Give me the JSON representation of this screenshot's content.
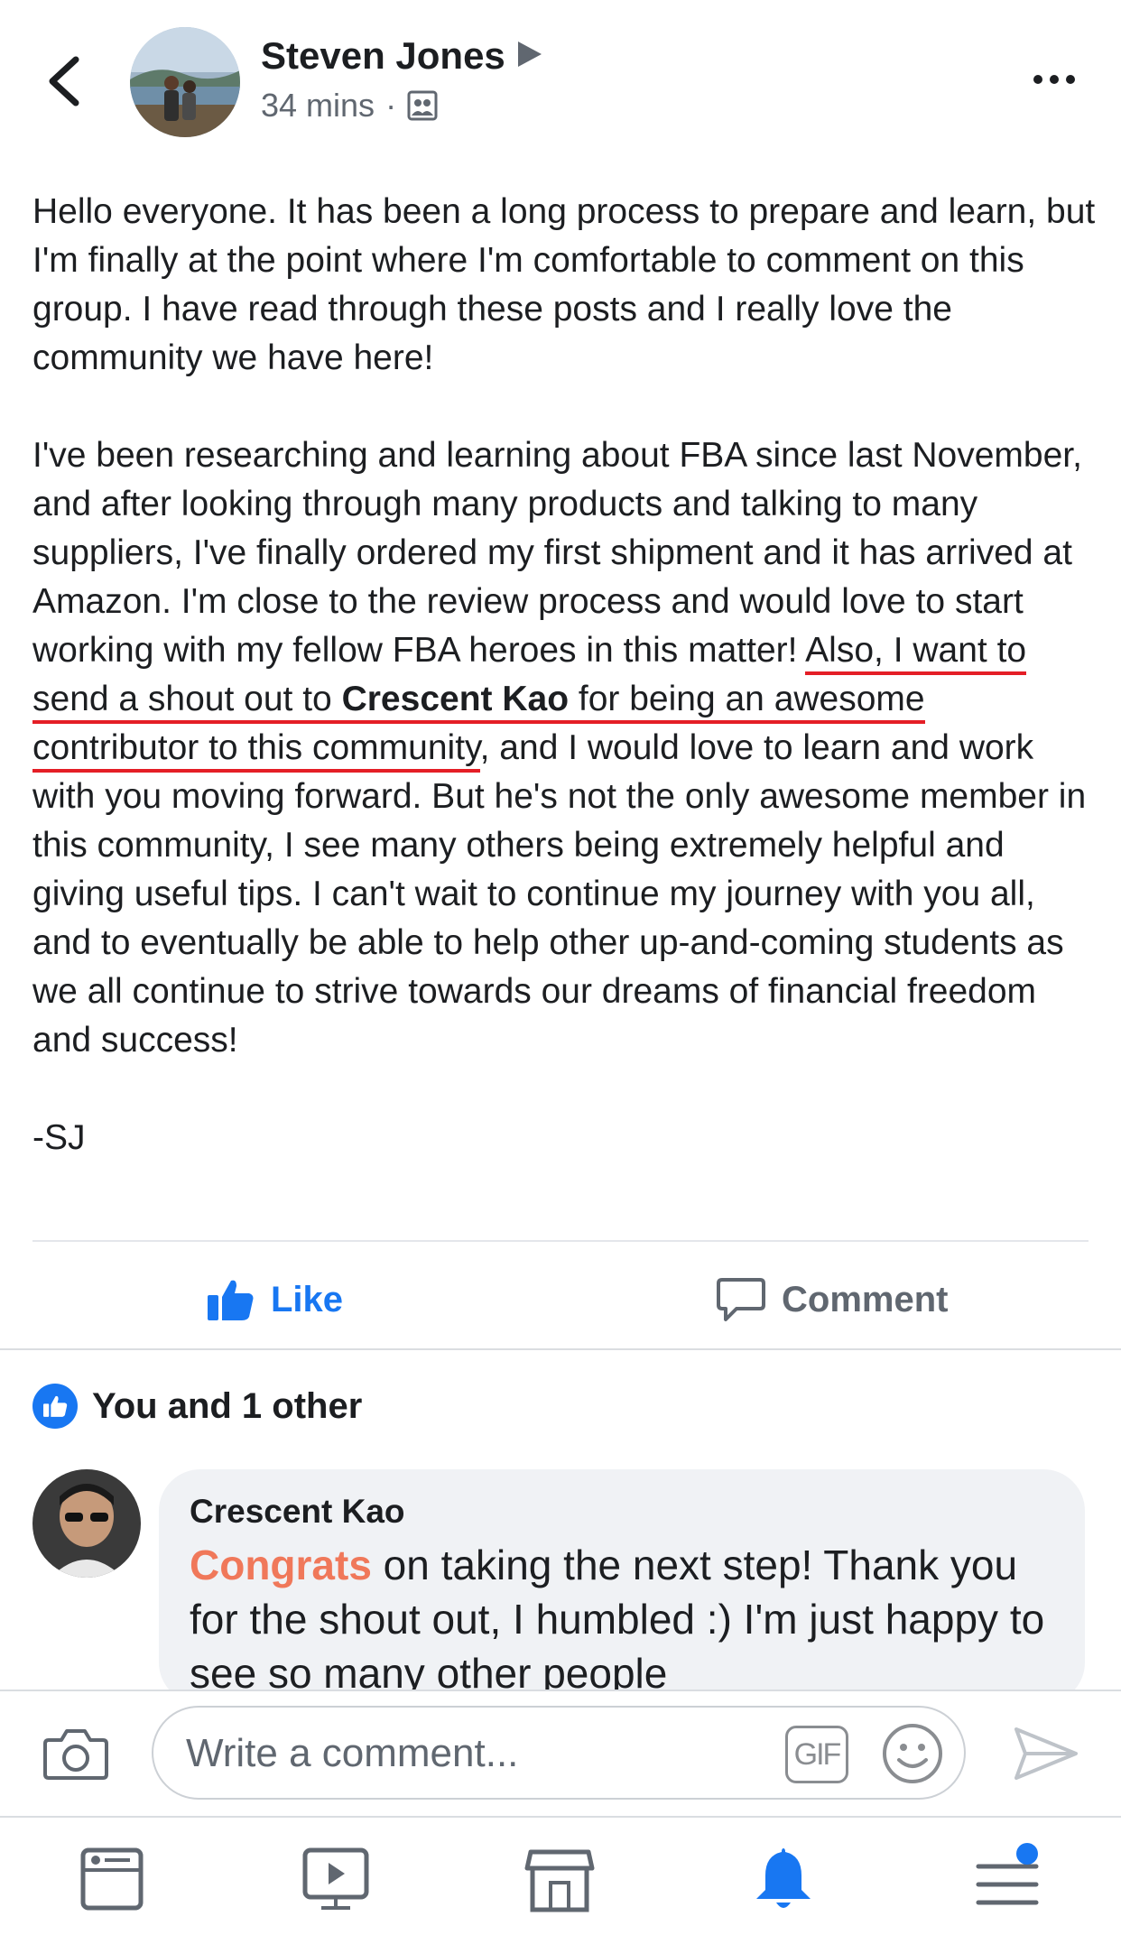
{
  "header": {
    "author": "Steven Jones",
    "time": "34 mins",
    "separator": "·"
  },
  "post": {
    "p1": "Hello everyone. It has been a long process to prepare and learn, but I'm finally at the point where I'm comfortable to comment on this group. I have read through these posts and I really love the community we have here!",
    "p2_a": "I've been researching and learning about FBA since last November, and after looking through many products and talking to many suppliers, I've finally ordered my first shipment and it has arrived at Amazon. I'm close to the review process and would love to start working with my fellow FBA heroes in this matter! ",
    "p2_u1": "Also, I want to send a shout out to ",
    "p2_name": "Crescent Kao",
    "p2_u2": " for being an awesome contributor to this community",
    "p2_b": ", and I would love to learn and work with you moving forward. But he's not the only awesome member in this community, I see many others being extremely helpful and giving useful tips. I can't wait to continue my journey with you all, and to eventually be able to help other up-and-coming students as we all continue to strive towards our dreams of financial freedom and success!",
    "signature": "-SJ"
  },
  "actions": {
    "like": "Like",
    "comment": "Comment"
  },
  "reactions": {
    "text": "You and 1 other"
  },
  "comment": {
    "author": "Crescent Kao",
    "highlight": "Congrats",
    "text": " on taking the next step! Thank you for the shout out, I humbled :) I'm just happy to see so many other people"
  },
  "composer": {
    "placeholder": "Write a comment...",
    "gif_label": "GIF"
  },
  "tabbar": {
    "items": [
      "news-feed-icon",
      "watch-icon",
      "marketplace-icon",
      "notifications-icon",
      "menu-icon"
    ],
    "active": "notifications-icon"
  },
  "colors": {
    "accent": "#1877f2",
    "underline": "#e41e26",
    "highlight": "#f0785a"
  }
}
